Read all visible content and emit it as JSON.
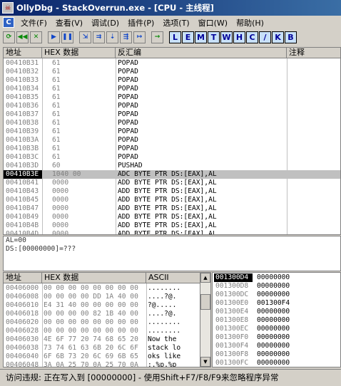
{
  "window": {
    "title": "OllyDbg - StackOverrun.exe - [CPU - 主线程]",
    "icon_glyph": "☠"
  },
  "menu": {
    "sys_glyph": "C",
    "items": [
      "文件(F)",
      "查看(V)",
      "调试(D)",
      "插件(P)",
      "选项(T)",
      "窗口(W)",
      "帮助(H)"
    ]
  },
  "toolbar": {
    "icons": [
      "open-icon",
      "rewind-icon",
      "close-icon",
      "run-icon",
      "pause-icon",
      "step-into-icon",
      "step-over-icon",
      "trace-into-icon",
      "trace-over-icon",
      "execute-till-return-icon",
      "goto-icon"
    ],
    "letter_buttons": [
      "L",
      "E",
      "M",
      "T",
      "W",
      "H",
      "C",
      "/",
      "K",
      "B"
    ]
  },
  "disasm": {
    "headers": {
      "address": "地址",
      "hex": "HEX 数据",
      "disasm": "反汇编",
      "comment": "注释"
    },
    "rows": [
      {
        "addr": "00410B31",
        "hex": "61",
        "asm": "POPAD"
      },
      {
        "addr": "00410B32",
        "hex": "61",
        "asm": "POPAD"
      },
      {
        "addr": "00410B33",
        "hex": "61",
        "asm": "POPAD"
      },
      {
        "addr": "00410B34",
        "hex": "61",
        "asm": "POPAD"
      },
      {
        "addr": "00410B35",
        "hex": "61",
        "asm": "POPAD"
      },
      {
        "addr": "00410B36",
        "hex": "61",
        "asm": "POPAD"
      },
      {
        "addr": "00410B37",
        "hex": "61",
        "asm": "POPAD"
      },
      {
        "addr": "00410B38",
        "hex": "61",
        "asm": "POPAD"
      },
      {
        "addr": "00410B39",
        "hex": "61",
        "asm": "POPAD"
      },
      {
        "addr": "00410B3A",
        "hex": "61",
        "asm": "POPAD"
      },
      {
        "addr": "00410B3B",
        "hex": "61",
        "asm": "POPAD"
      },
      {
        "addr": "00410B3C",
        "hex": "61",
        "asm": "POPAD"
      },
      {
        "addr": "00410B3D",
        "hex": "60",
        "asm": "PUSHAD"
      },
      {
        "addr": "00410B3E",
        "hex": "1040 00",
        "asm": "ADC BYTE PTR DS:[EAX],AL",
        "selected": true
      },
      {
        "addr": "00410B41",
        "hex": "0000",
        "asm": "ADD BYTE PTR DS:[EAX],AL"
      },
      {
        "addr": "00410B43",
        "hex": "0000",
        "asm": "ADD BYTE PTR DS:[EAX],AL"
      },
      {
        "addr": "00410B45",
        "hex": "0000",
        "asm": "ADD BYTE PTR DS:[EAX],AL"
      },
      {
        "addr": "00410B47",
        "hex": "0000",
        "asm": "ADD BYTE PTR DS:[EAX],AL"
      },
      {
        "addr": "00410B49",
        "hex": "0000",
        "asm": "ADD BYTE PTR DS:[EAX],AL"
      },
      {
        "addr": "00410B4B",
        "hex": "0000",
        "asm": "ADD BYTE PTR DS:[EAX],AL"
      },
      {
        "addr": "00410B4D",
        "hex": "0000",
        "asm": "ADD BYTE PTR DS:[EAX],AL"
      }
    ]
  },
  "info": {
    "lines": [
      "AL=00",
      "DS:[00000000]=???"
    ]
  },
  "dump": {
    "headers": {
      "address": "地址",
      "hex": "HEX 数据",
      "ascii": "ASCII"
    },
    "rows": [
      {
        "addr": "00406000",
        "hex": "00 00 00 00 00 00 00 00",
        "ascii": "........"
      },
      {
        "addr": "00406008",
        "hex": "00 00 00 00 DD 1A 40 00",
        "ascii": "....?@."
      },
      {
        "addr": "00406010",
        "hex": "E4 31 40 00 00 00 00 00",
        "ascii": "?@....."
      },
      {
        "addr": "00406018",
        "hex": "00 00 00 00 82 1B 40 00",
        "ascii": "....?@."
      },
      {
        "addr": "00406020",
        "hex": "00 00 00 00 00 00 00 00",
        "ascii": "........"
      },
      {
        "addr": "00406028",
        "hex": "00 00 00 00 00 00 00 00",
        "ascii": "........"
      },
      {
        "addr": "00406030",
        "hex": "4E 6F 77 20 74 68 65 20",
        "ascii": "Now the "
      },
      {
        "addr": "00406038",
        "hex": "73 74 61 63 6B 20 6C 6F",
        "ascii": "stack lo"
      },
      {
        "addr": "00406040",
        "hex": "6F 6B 73 20 6C 69 6B 65",
        "ascii": "oks like"
      },
      {
        "addr": "00406048",
        "hex": "3A 0A 25 70 0A 25 70 0A",
        "ascii": ":.%p.%p"
      }
    ]
  },
  "stack": {
    "rows": [
      {
        "addr": "001300D4",
        "val": "00000000",
        "selected": true
      },
      {
        "addr": "001300D8",
        "val": "00000000"
      },
      {
        "addr": "001300DC",
        "val": "00000000"
      },
      {
        "addr": "001300E0",
        "val": "001300F4"
      },
      {
        "addr": "001300E4",
        "val": "00000000"
      },
      {
        "addr": "001300E8",
        "val": "00000000"
      },
      {
        "addr": "001300EC",
        "val": "00000000"
      },
      {
        "addr": "001300F0",
        "val": "00000000"
      },
      {
        "addr": "001300F4",
        "val": "00000000"
      },
      {
        "addr": "001300F8",
        "val": "00000000"
      },
      {
        "addr": "001300FC",
        "val": "00000000"
      }
    ]
  },
  "status": {
    "text": "访问违规: 正在写入到 [00000000] - 使用Shift+F7/F8/F9来忽略程序异常"
  }
}
